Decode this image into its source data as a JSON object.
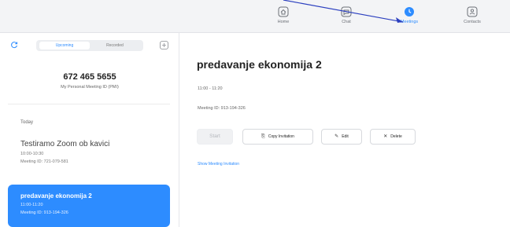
{
  "nav": {
    "items": [
      {
        "label": "Home",
        "icon": "home-icon"
      },
      {
        "label": "Chat",
        "icon": "chat-icon"
      },
      {
        "label": "Meetings",
        "icon": "clock-icon",
        "active": true
      },
      {
        "label": "Contacts",
        "icon": "contacts-icon"
      }
    ]
  },
  "colors": {
    "accent": "#2d8cff",
    "topbar": "#f3f4f6",
    "annotation_arrow": "#2b3fbf"
  },
  "sidebar": {
    "tabs": [
      "Upcoming",
      "Recorded"
    ],
    "active_tab": "Upcoming",
    "pmi": {
      "number": "672 465 5655",
      "label": "My Personal Meeting ID (PMI)"
    },
    "section": "Today",
    "meetings": [
      {
        "title": "Testiramo Zoom ob kavici",
        "time": "10:00-10:30",
        "meeting_id": "Meeting ID: 721-079-581",
        "selected": false
      },
      {
        "title": "predavanje ekonomija 2",
        "time": "11:00-11:20",
        "meeting_id": "Meeting ID: 913-194-326",
        "selected": true
      }
    ]
  },
  "detail": {
    "title": "predavanje ekonomija 2",
    "time": "11:00 - 11:20",
    "meeting_id": "Meeting ID: 913-194-326",
    "buttons": {
      "start": "Start",
      "copy": "Copy Invitation",
      "edit": "Edit",
      "delete": "Delete"
    },
    "show_invitation": "Show Meeting Invitation"
  }
}
